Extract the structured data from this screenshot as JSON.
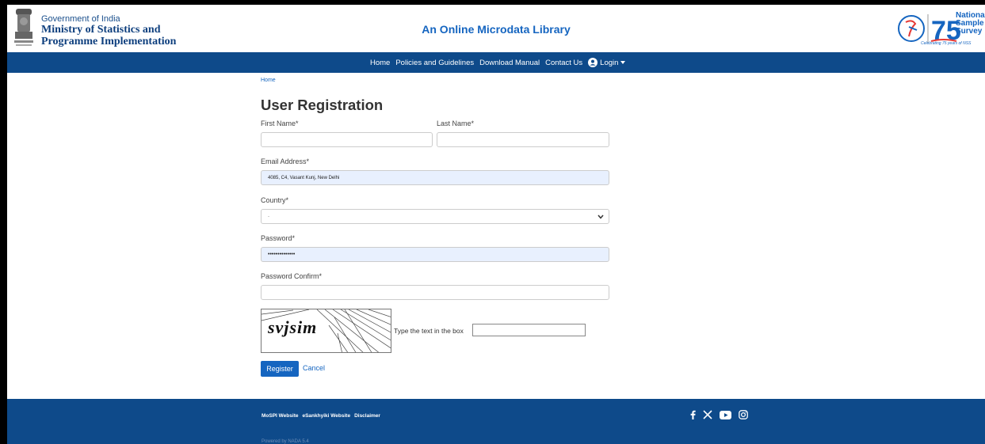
{
  "header": {
    "gov_line1": "Government of India",
    "gov_line2": "Ministry of Statistics and",
    "gov_line3": "Programme Implementation",
    "site_title": "An Online Microdata Library",
    "nss_line1": "National",
    "nss_line2": "Sample",
    "nss_line3": "Survey",
    "nss_tagline": "Celebrating 75 years of NSS",
    "colors": {
      "primary": "#0e4a8a",
      "link": "#1565c0"
    }
  },
  "nav": {
    "items": [
      "Home",
      "Policies and Guidelines",
      "Download Manual",
      "Contact Us"
    ],
    "login_label": "Login"
  },
  "breadcrumb": {
    "home": "Home"
  },
  "form": {
    "title": "User Registration",
    "first_name_label": "First Name*",
    "first_name_value": "",
    "last_name_label": "Last Name*",
    "last_name_value": "",
    "email_label": "Email Address*",
    "email_value": "4085, C4, Vasant Kunj, New Delhi",
    "country_label": "Country*",
    "country_value": "-",
    "password_label": "Password*",
    "password_value": "••••••••••••••",
    "password_confirm_label": "Password Confirm*",
    "password_confirm_value": "",
    "captcha_text": "svjsim",
    "captcha_label": "Type the text in the box",
    "captcha_value": "",
    "register_label": "Register",
    "cancel_label": "Cancel"
  },
  "footer": {
    "links": [
      "MoSPI Website",
      "eSankhyiki Website",
      "Disclaimer"
    ],
    "powered_by": "Powered by NADA 5.4",
    "socials": [
      "facebook-icon",
      "x-icon",
      "youtube-icon",
      "instagram-icon"
    ]
  }
}
